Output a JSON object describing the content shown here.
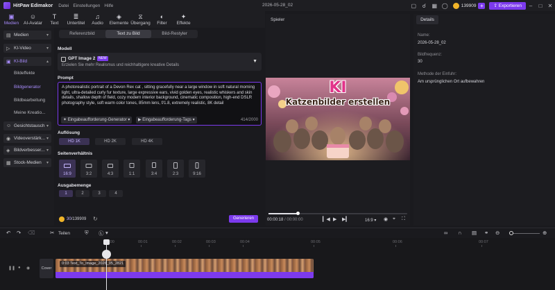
{
  "app": {
    "name": "HitPaw Edimakor",
    "menus": [
      "Datei",
      "Einstellungen",
      "Hilfe"
    ],
    "window_title": "2026-05-28_02",
    "credits": "139909",
    "export_label": "Exportieren"
  },
  "toolbar": [
    {
      "label": "Medien",
      "icon": "media-icon",
      "glyph": "▣"
    },
    {
      "label": "AI-Avatar",
      "icon": "avatar-icon",
      "glyph": "☺"
    },
    {
      "label": "Text",
      "icon": "text-icon",
      "glyph": "T"
    },
    {
      "label": "Untertitel",
      "icon": "subtitle-icon",
      "glyph": "≣"
    },
    {
      "label": "Audio",
      "icon": "audio-icon",
      "glyph": "♫"
    },
    {
      "label": "Elemente",
      "icon": "elements-icon",
      "glyph": "◈"
    },
    {
      "label": "Übergang",
      "icon": "transition-icon",
      "glyph": "⧖"
    },
    {
      "label": "Filter",
      "icon": "filter-icon",
      "glyph": "◐"
    },
    {
      "label": "Effekte",
      "icon": "effects-icon",
      "glyph": "✦"
    }
  ],
  "sidebar": {
    "items": [
      {
        "label": "Medien",
        "icon": "folder-icon"
      },
      {
        "label": "KI-Video",
        "icon": "ai-video-icon"
      },
      {
        "label": "KI-Bild",
        "icon": "ai-image-icon"
      },
      {
        "label": "Gesichtstausch",
        "icon": "face-swap-icon"
      },
      {
        "label": "Videoverstärk...",
        "icon": "video-enhance-icon"
      },
      {
        "label": "Bildverbesser...",
        "icon": "image-enhance-icon"
      },
      {
        "label": "Stock-Medien",
        "icon": "stock-media-icon"
      }
    ],
    "sub_items": [
      "Bildeffekte",
      "Bildgenerator",
      "Bildbearbeitung",
      "Meine Kreatio..."
    ]
  },
  "panel": {
    "tabs": [
      "Referenzbild",
      "Text zu Bild",
      "Bild-Restyler"
    ],
    "model_label": "Modell",
    "model_name": "GPT Image 2",
    "model_badge": "NEW",
    "model_desc": "Erzielen Sie mehr Realismus und reichhaltigere kreative Details",
    "prompt_label": "Prompt",
    "prompt_text": "A photorealistic portrait of a Devon Rex cat , sitting gracefully near a large window in soft natural morning light, ultra-detailed curly fur texture, large expressive ears, vivid golden eyes, realistic whiskers and skin details, shallow depth of field, cozy modern interior background, cinematic composition, high-end DSLR photography style, soft warm color tones, 85mm lens, f/1.8, extremely realistic, 8K detail",
    "prompt_gen_label": "Eingabeaufforderung-Generator",
    "prompt_tags_label": "Eingabeaufforderung-Tags",
    "char_count": "414/2000",
    "resolution_label": "Auflösung",
    "resolutions": [
      "HD 1K",
      "HD 2K",
      "HD 4K"
    ],
    "ratio_label": "Seitenverhältnis",
    "ratios": [
      "16:9",
      "3:2",
      "4:3",
      "1:1",
      "3:4",
      "2:3",
      "9:16"
    ],
    "output_label": "Ausgabemenge",
    "outputs": [
      "1",
      "2",
      "3",
      "4"
    ],
    "cost_value": "30",
    "cost_total": "/139909",
    "generate_label": "Generieren"
  },
  "player": {
    "title": "Spieler",
    "image_title_top": "KI",
    "image_title_bottom": "Katzenbilder erstellen",
    "time_current": "00:00:18",
    "time_total": "/ 00:00:00",
    "ratio": "16:9",
    "progress": 0.21
  },
  "details": {
    "tab": "Details",
    "name_label": "Name:",
    "name_value": "2026-05-28_02",
    "fps_label": "Bildfrequenz:",
    "fps_value": "30",
    "method_label": "Methode der Einfuhr:",
    "method_value": "Am ursprünglichen Ort aufbewahren"
  },
  "timeline": {
    "split_label": "Teilen",
    "ruler": [
      "00:00",
      "00:01",
      "00:02",
      "00:03",
      "00:04",
      "00:05",
      "00:06",
      "00:07"
    ],
    "cover_label": "Cover",
    "clip_label": "0:03 Text_To_Image_2026_05_2821"
  },
  "colors": {
    "accent": "#7c3aed",
    "accent_light": "#a78bfa",
    "background": "#1a1a1e"
  }
}
